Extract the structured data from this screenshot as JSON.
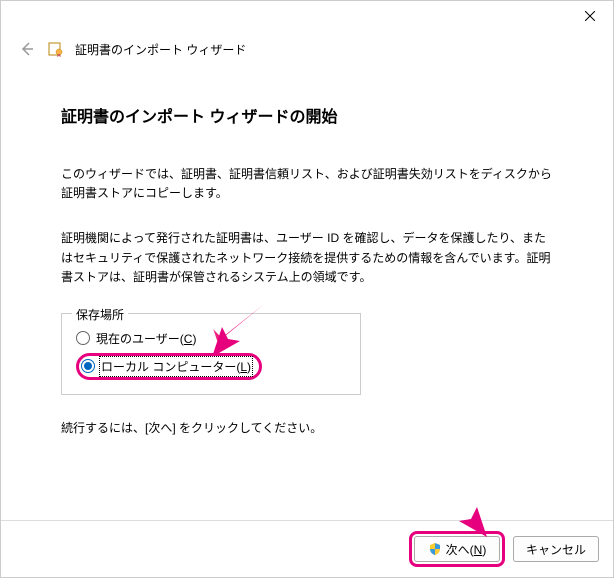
{
  "header": {
    "window_title": "証明書のインポート ウィザード"
  },
  "content": {
    "heading": "証明書のインポート ウィザードの開始",
    "para1": "このウィザードでは、証明書、証明書信頼リスト、および証明書失効リストをディスクから証明書ストアにコピーします。",
    "para2": "証明機関によって発行された証明書は、ユーザー ID を確認し、データを保護したり、またはセキュリティで保護されたネットワーク接続を提供するための情報を含んでいます。証明書ストアは、証明書が保管されるシステム上の領域です。",
    "store_location_label": "保存場所",
    "radio_current_user_prefix": "現在のユーザー(",
    "radio_current_user_key": "C",
    "radio_current_user_suffix": ")",
    "radio_local_computer_prefix": "ローカル コンピューター(",
    "radio_local_computer_key": "L",
    "radio_local_computer_suffix": ")",
    "continue_text": "続行するには、[次へ] をクリックしてください。"
  },
  "footer": {
    "next_prefix": "次へ(",
    "next_key": "N",
    "next_suffix": ")",
    "cancel_label": "キャンセル"
  }
}
